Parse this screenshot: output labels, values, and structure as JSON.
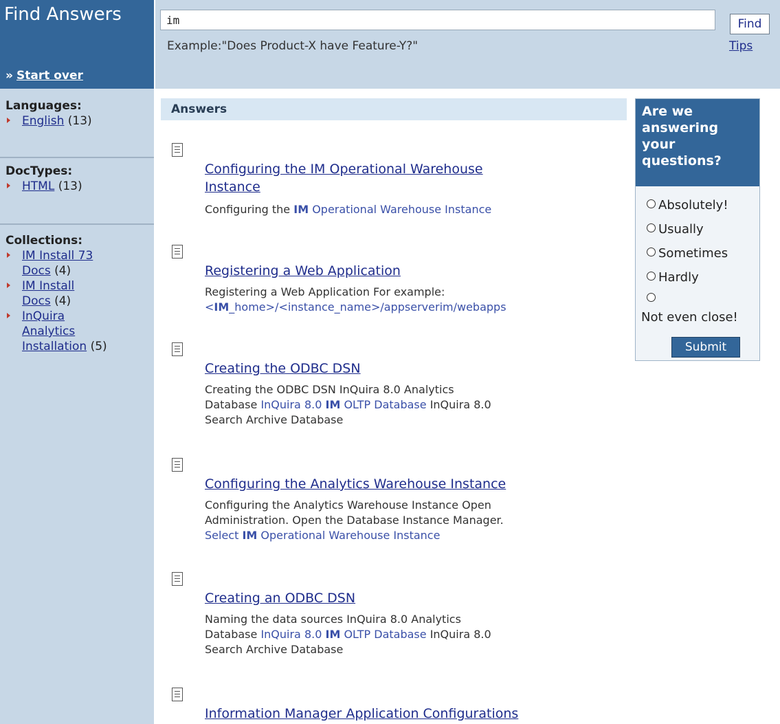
{
  "brand": {
    "title": "Find Answers",
    "start_over": "Start over"
  },
  "search": {
    "value": "im",
    "find_label": "Find",
    "example": "Example:\"Does Product-X have Feature-Y?\"",
    "tips": "Tips"
  },
  "sidebar": {
    "languages": {
      "heading": "Languages:",
      "items": [
        {
          "label": "English",
          "count": "(13)"
        }
      ]
    },
    "doctypes": {
      "heading": "DocTypes:",
      "items": [
        {
          "label": "HTML",
          "count": "(13)"
        }
      ]
    },
    "collections": {
      "heading": "Collections:",
      "items": [
        {
          "label_l1": "IM Install 73",
          "label_l2": "Docs",
          "count": "(4)"
        },
        {
          "label_l1": "IM Install",
          "label_l2": "Docs",
          "count": "(4)"
        },
        {
          "label_l1": "InQuira",
          "label_l2": "Analytics",
          "label_l3": "Installation",
          "count": "(5)"
        }
      ]
    }
  },
  "answers": {
    "heading": "Answers",
    "results": [
      {
        "title_l1": "Configuring the IM Operational Warehouse",
        "title_l2": "Instance",
        "snippet": {
          "a": "Configuring the ",
          "b": "IM",
          "c": " Operational Warehouse Instance"
        }
      },
      {
        "title": "Registering a Web Application",
        "snippet": {
          "a": "Registering a Web Application For example:",
          "b": "<",
          "c": "IM",
          "d": "_home>/<instance_name>/appserverim/webapps"
        }
      },
      {
        "title": "Creating the ODBC DSN",
        "snippet": {
          "a": "Creating the ODBC DSN InQuira 8.0 Analytics",
          "b": "Database ",
          "c": "InQuira 8.0 ",
          "d": "IM",
          "e": " OLTP Database",
          "f": " InQuira 8.0",
          "g": "Search Archive Database"
        }
      },
      {
        "title": "Configuring the Analytics Warehouse Instance",
        "snippet": {
          "a": "Configuring the Analytics Warehouse Instance Open",
          "b": "Administration. Open the Database Instance Manager.",
          "c": "Select ",
          "d": "IM",
          "e": " Operational Warehouse Instance"
        }
      },
      {
        "title": "Creating an ODBC DSN",
        "snippet": {
          "a": "Naming the data sources InQuira 8.0 Analytics",
          "b": "Database ",
          "c": "InQuira 8.0 ",
          "d": "IM",
          "e": " OLTP Database",
          "f": " InQuira 8.0",
          "g": "Search Archive Database"
        }
      },
      {
        "title": "Information Manager Application Configurations"
      }
    ]
  },
  "feedback": {
    "question_l1": "Are we",
    "question_l2": "answering",
    "question_l3": "your",
    "question_l4": "questions?",
    "options": [
      "Absolutely!",
      "Usually",
      "Sometimes",
      "Hardly",
      "Not even close!"
    ],
    "submit": "Submit"
  }
}
